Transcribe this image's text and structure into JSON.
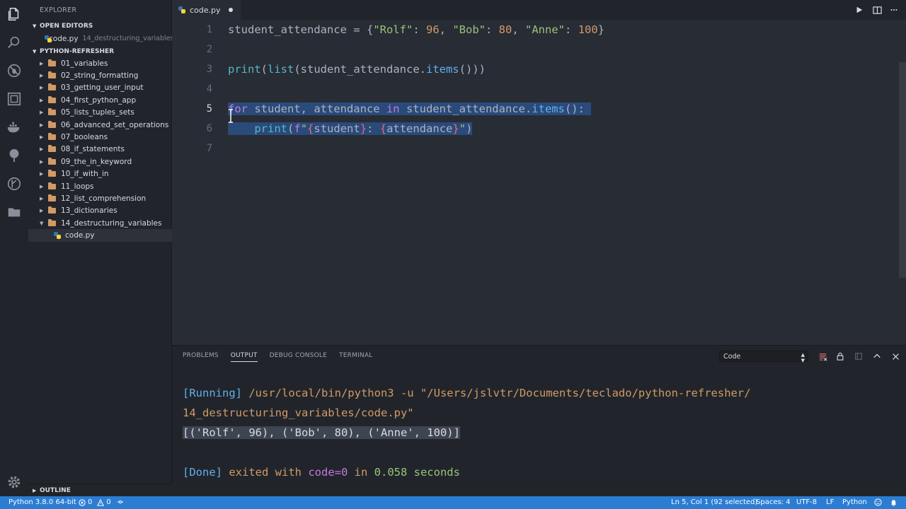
{
  "sidebar": {
    "title": "EXPLORER",
    "open_editors_label": "OPEN EDITORS",
    "open_editor": {
      "name": "code.py",
      "path": "14_destructuring_variables"
    },
    "project_label": "PYTHON-REFRESHER",
    "folders": [
      "01_variables",
      "02_string_formatting",
      "03_getting_user_input",
      "04_first_python_app",
      "05_lists_tuples_sets",
      "06_advanced_set_operations",
      "07_booleans",
      "08_if_statements",
      "09_the_in_keyword",
      "10_if_with_in",
      "11_loops",
      "12_list_comprehension",
      "13_dictionaries",
      "14_destructuring_variables"
    ],
    "active_file": "code.py",
    "outline_label": "OUTLINE"
  },
  "editor": {
    "tab_label": "code.py",
    "line_numbers": [
      "1",
      "2",
      "3",
      "4",
      "5",
      "6",
      "7"
    ]
  },
  "panel": {
    "tabs": [
      "PROBLEMS",
      "OUTPUT",
      "DEBUG CONSOLE",
      "TERMINAL"
    ],
    "active_tab": "OUTPUT",
    "channel": "Code",
    "running_tag": "[Running]",
    "running_cmd": " /usr/local/bin/python3 -u \"/Users/jslvtr/Documents/teclado/python-refresher/",
    "running_cmd2": "14_destructuring_variables/code.py\"",
    "result": "[('Rolf', 96), ('Bob', 80), ('Anne', 100)]",
    "done_tag": "[Done]",
    "exited_with": " exited with ",
    "code_eq": "code=0",
    "in_word": " in ",
    "seconds": "0.058 seconds"
  },
  "status": {
    "interpreter": "Python 3.8.0 64-bit",
    "errors": "0",
    "warnings": "0",
    "position": "Ln 5, Col 1 (92 selected)",
    "spaces": "Spaces: 4",
    "encoding": "UTF-8",
    "eol": "LF",
    "language": "Python"
  },
  "colors": {
    "status_bar": "#2b7dd4",
    "editor_bg": "#282c34",
    "sidebar_bg": "#21252b"
  }
}
